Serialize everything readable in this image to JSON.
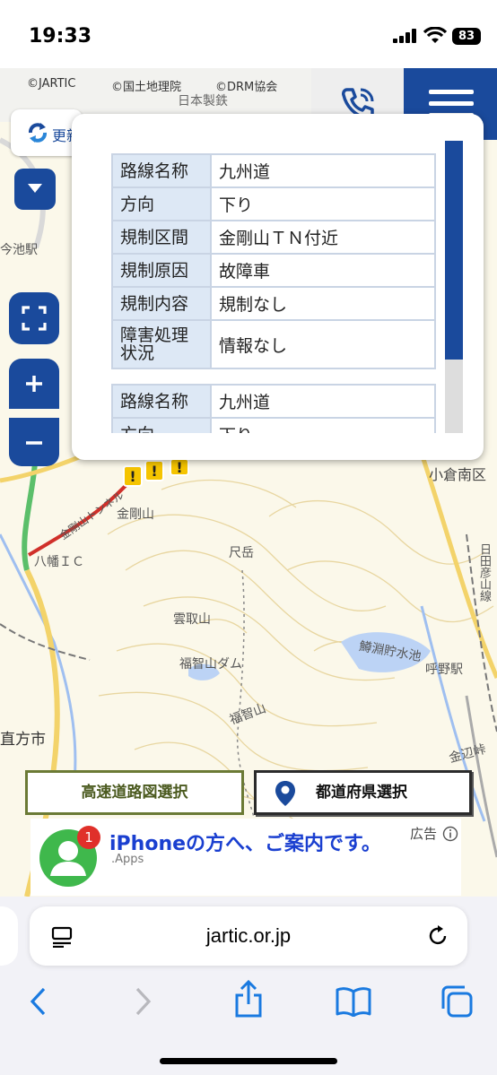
{
  "status_bar": {
    "time": "19:33",
    "battery": "83"
  },
  "map": {
    "attributions": [
      "©JARTIC",
      "©国土地理院",
      "©DRM協会"
    ],
    "labels": [
      "日本製鉄",
      "今池駅",
      "金剛山トンネル",
      "八幡ＩＣ",
      "金剛山",
      "尺岳",
      "雲取山",
      "福智山ダム",
      "福智山",
      "鱒淵貯水池",
      "呼野駅",
      "直方市",
      "小倉南区",
      "日田彦山線",
      "金辺峠"
    ],
    "update_label": "更新"
  },
  "popup": {
    "records": [
      {
        "rows": [
          {
            "key": "路線名称",
            "value": "九州道"
          },
          {
            "key": "方向",
            "value": "下り"
          },
          {
            "key": "規制区間",
            "value": "金剛山ＴＮ付近"
          },
          {
            "key": "規制原因",
            "value": "故障車"
          },
          {
            "key": "規制内容",
            "value": "規制なし"
          },
          {
            "key": "障害処理状況",
            "value": "情報なし"
          }
        ]
      },
      {
        "rows": [
          {
            "key": "路線名称",
            "value": "九州道"
          },
          {
            "key": "方向",
            "value": "下り"
          }
        ]
      }
    ]
  },
  "buttons": {
    "highway_map": "高速道路図選択",
    "prefecture": "都道府県選択"
  },
  "ad": {
    "title": "iPhoneの方へ、ご案内です。",
    "subtitle": ".Apps",
    "label": "広告",
    "badge": "1"
  },
  "browser": {
    "url": "jartic.or.jp"
  },
  "colors": {
    "brand_blue": "#1a4a9c",
    "route_red": "#d0302a",
    "warning_yellow": "#f5c400"
  }
}
